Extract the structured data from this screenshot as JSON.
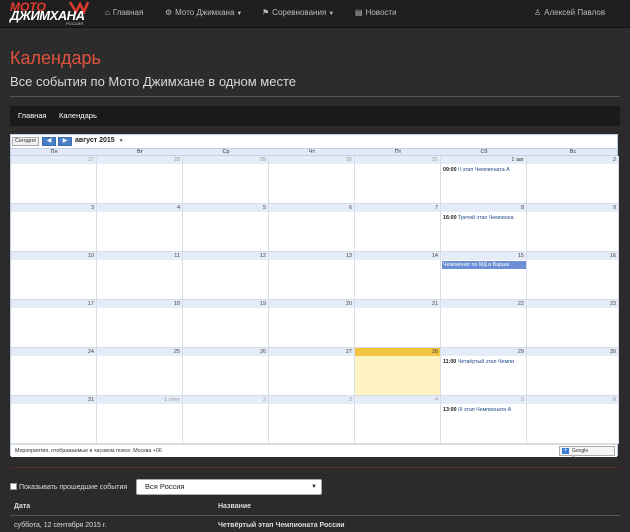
{
  "logo": {
    "line1": "МОТО",
    "line2": "ДЖИМХАНА",
    "line3": "РОССИЯ"
  },
  "nav": {
    "home": "Главная",
    "moto": "Мото Джимхана",
    "competitions": "Соревнования",
    "news": "Новости",
    "user": "Алексей Павлов"
  },
  "hero": {
    "title": "Календарь",
    "subtitle": "Все события по Мото Джимхане в одном месте"
  },
  "breadcrumb": {
    "home": "Главная",
    "current": "Календарь"
  },
  "calendar": {
    "today_label": "Сегодня",
    "month_label": "август 2015",
    "dow": [
      "Пн",
      "Вт",
      "Ср",
      "Чт",
      "Пт",
      "Сб",
      "Вс"
    ],
    "weeks": [
      [
        "27",
        "28",
        "29",
        "30",
        "31",
        "1 авг",
        "2"
      ],
      [
        "3",
        "4",
        "5",
        "6",
        "7",
        "8",
        "9"
      ],
      [
        "10",
        "11",
        "12",
        "13",
        "14",
        "15",
        "16"
      ],
      [
        "17",
        "18",
        "19",
        "20",
        "21",
        "22",
        "23"
      ],
      [
        "24",
        "25",
        "26",
        "27",
        "28",
        "29",
        "30"
      ],
      [
        "31",
        "1 сент",
        "2",
        "3",
        "4",
        "5",
        "6"
      ]
    ],
    "events": {
      "w0": {
        "time": "09:00",
        "title": "II этап Чемпионата А"
      },
      "w1": {
        "time": "16:00",
        "title": "Третий этап Чемпиона"
      },
      "w2": {
        "title": "Чемпионат по МД в Варша"
      },
      "w4": {
        "time": "11:00",
        "title": "Четвёртый этап Чемпи"
      },
      "w5": {
        "time": "13:00",
        "title": "III этап Чемпионата А"
      }
    },
    "timezone_note": "Мероприятия, отображаемые в часовом поясе: Москва +00",
    "gcal_label": "Google Календарь"
  },
  "filters": {
    "show_past": "Показывать прошедшие события",
    "region": "Вся Россия"
  },
  "table": {
    "headers": {
      "date": "Дата",
      "name": "Название"
    },
    "rows": [
      {
        "date": "суббота, 12 сентября 2015 г.",
        "name": "Четвёртый этап Чемпионата России"
      }
    ]
  }
}
